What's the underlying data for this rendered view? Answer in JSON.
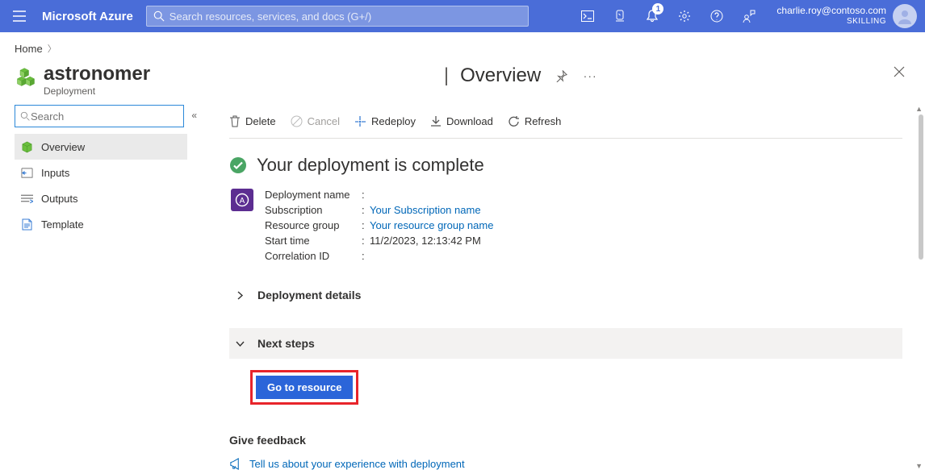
{
  "header": {
    "brand": "Microsoft Azure",
    "search_placeholder": "Search resources, services, and docs (G+/)",
    "notification_count": "1",
    "user_email": "charlie.roy@contoso.com",
    "tenant": "SKILLING"
  },
  "breadcrumb": {
    "home": "Home"
  },
  "resource": {
    "title": "astronomer",
    "subtitle": "Deployment",
    "section_divider": "|",
    "section_label": "Overview"
  },
  "sidebar": {
    "search_placeholder": "Search",
    "items": [
      {
        "label": "Overview"
      },
      {
        "label": "Inputs"
      },
      {
        "label": "Outputs"
      },
      {
        "label": "Template"
      }
    ]
  },
  "cmdbar": {
    "delete": "Delete",
    "cancel": "Cancel",
    "redeploy": "Redeploy",
    "download": "Download",
    "refresh": "Refresh"
  },
  "status": {
    "title": "Your deployment is complete"
  },
  "details": {
    "deployment_name_label": "Deployment name",
    "deployment_name_value": "",
    "subscription_label": "Subscription",
    "subscription_value": "Your Subscription name",
    "resource_group_label": "Resource group",
    "resource_group_value": "Your resource group name",
    "start_time_label": "Start time",
    "start_time_value": "11/2/2023, 12:13:42 PM",
    "correlation_id_label": "Correlation ID",
    "correlation_id_value": ""
  },
  "sections": {
    "deployment_details": "Deployment details",
    "next_steps": "Next steps",
    "go_to_resource": "Go to resource"
  },
  "feedback": {
    "title": "Give feedback",
    "link": "Tell us about your experience with deployment"
  }
}
